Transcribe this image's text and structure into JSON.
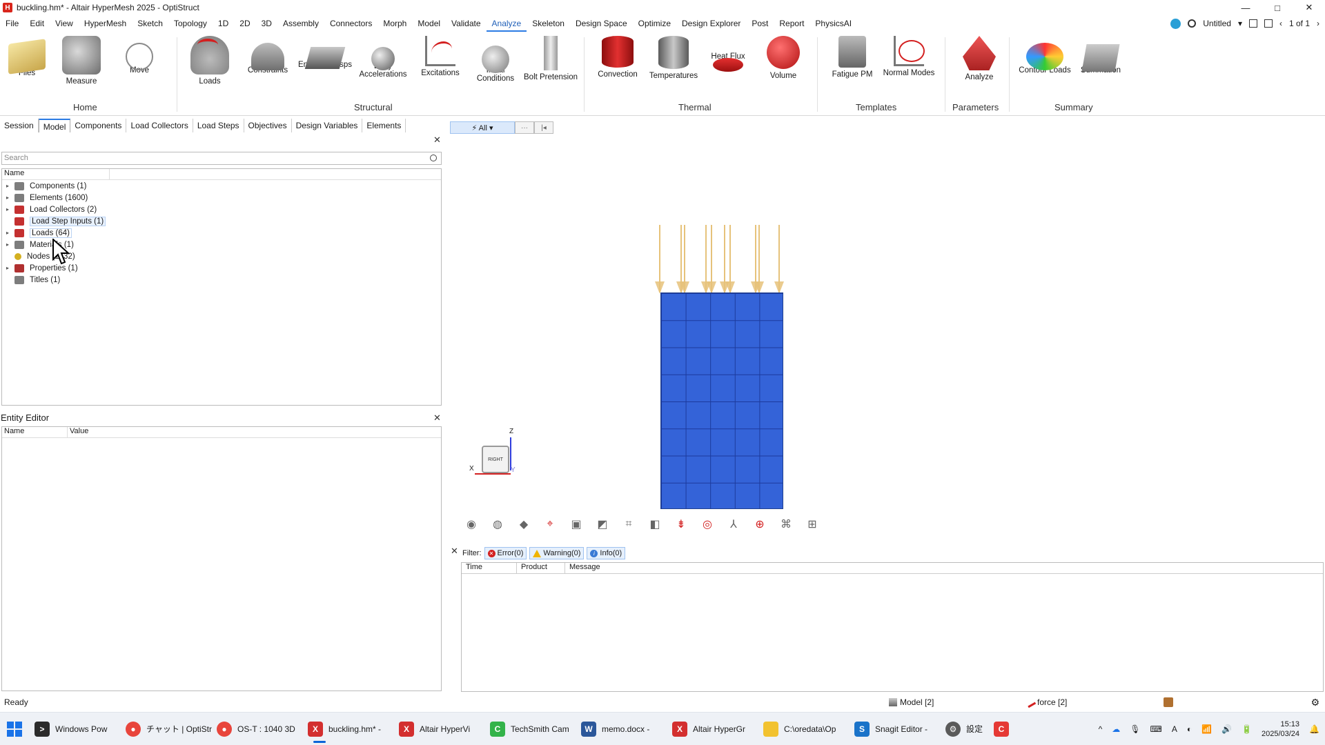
{
  "window": {
    "title": "buckling.hm* - Altair HyperMesh 2025 - OptiStruct",
    "controls": [
      "—",
      "□",
      "✕"
    ]
  },
  "menubar": {
    "items": [
      "File",
      "Edit",
      "View",
      "HyperMesh",
      "Sketch",
      "Topology",
      "1D",
      "2D",
      "3D",
      "Assembly",
      "Connectors",
      "Morph",
      "Model",
      "Validate",
      "Analyze",
      "Skeleton",
      "Design Space",
      "Optimize",
      "Design Explorer",
      "Post",
      "Report",
      "PhysicsAI"
    ],
    "active": "Analyze",
    "session_name": "Untitled",
    "page_counter": "1 of 1"
  },
  "ribbon": {
    "home": {
      "files": "Files",
      "measure": "Measure",
      "move": "Move",
      "group": "Home"
    },
    "structural": {
      "loads": "Loads",
      "constraints": "Constraints",
      "enforced": "Enforced Disps",
      "body_acc": "Body Accelerations",
      "excitations": "Excitations",
      "initial": "Initial Conditions",
      "bolt": "Bolt Pretension",
      "group": "Structural"
    },
    "thermal": {
      "convection": "Convection",
      "temperatures": "Temperatures",
      "heatflux": "Heat Flux",
      "volume": "Volume",
      "group": "Thermal"
    },
    "templates": {
      "fatigue": "Fatigue PM",
      "normal": "Normal Modes",
      "group": "Templates"
    },
    "parameters": {
      "analyze": "Analyze",
      "group": "Parameters"
    },
    "summary": {
      "contour": "Contour Loads",
      "summation": "Summation",
      "group": "Summary"
    }
  },
  "browser_tabs": {
    "tabs": [
      "Session",
      "Model",
      "Components",
      "Load Collectors",
      "Load Steps",
      "Objectives",
      "Design Variables",
      "Elements"
    ],
    "active": "Model"
  },
  "entity_filter": {
    "all": "⚡ All ▾",
    "more": "···",
    "first": "|◂"
  },
  "model_browser": {
    "search_placeholder": "Search",
    "name_header": "Name",
    "rows": [
      {
        "label": "Components  (1)",
        "color": "#7d7d7d"
      },
      {
        "label": "Elements  (1600)",
        "color": "#7d7d7d"
      },
      {
        "label": "Load Collectors  (2)",
        "color": "#c43030"
      },
      {
        "label": "Load Step Inputs  (1)",
        "color": "#c43030"
      },
      {
        "label": "Loads  (64)",
        "color": "#c43030"
      },
      {
        "label": "Materials  (1)",
        "color": "#7d7d7d"
      },
      {
        "label": "Nodes  (1632)",
        "color": "#d4b020"
      },
      {
        "label": "Properties  (1)",
        "color": "#b03030"
      },
      {
        "label": "Titles  (1)",
        "color": "#7d7d7d"
      }
    ]
  },
  "entity_editor": {
    "title": "Entity Editor",
    "name_col": "Name",
    "value_col": "Value"
  },
  "viewport": {
    "view_cube_label": "RIGHT",
    "axis_x": "X",
    "axis_y": "Y",
    "axis_z": "Z",
    "toolbar_icons": [
      "visualization-icon",
      "globe-icon",
      "shaded-icon",
      "fit-icon",
      "component-icon",
      "element-icon",
      "node-icon",
      "cut-plane-icon",
      "contour-icon",
      "pick-icon",
      "no-entry-icon",
      "axis-icon",
      "zoom-icon",
      "measure-icon",
      "lock-icon"
    ]
  },
  "message_log": {
    "filter_label": "Filter:",
    "error": "Error(0)",
    "warning": "Warning(0)",
    "info": "Info(0)",
    "columns": [
      "Time",
      "Product",
      "Message"
    ]
  },
  "status": {
    "ready": "Ready",
    "model": "Model [2]",
    "force": "force [2]"
  },
  "taskbar": {
    "items": [
      {
        "label": "Windows Pow",
        "icon_color": "#2b2b2b",
        "glyph": ">"
      },
      {
        "label": "チャット | OptiStr",
        "icon_color": "#e8453c",
        "glyph": "●"
      },
      {
        "label": "OS-T : 1040 3D",
        "icon_color": "#e8453c",
        "glyph": "●"
      },
      {
        "label": "buckling.hm* -",
        "icon_color": "#d32f2f",
        "glyph": "X"
      },
      {
        "label": "Altair HyperVi",
        "icon_color": "#d32f2f",
        "glyph": "X"
      },
      {
        "label": "TechSmith Cam",
        "icon_color": "#33b34a",
        "glyph": "C"
      },
      {
        "label": "memo.docx -",
        "icon_color": "#2b579a",
        "glyph": "W"
      },
      {
        "label": "Altair HyperGr",
        "icon_color": "#d32f2f",
        "glyph": "X"
      },
      {
        "label": "C:\\oredata\\Op",
        "icon_color": "#f2c230",
        "glyph": ""
      },
      {
        "label": "Snagit Editor -",
        "icon_color": "#1a73c9",
        "glyph": "S"
      },
      {
        "label": "設定",
        "icon_color": "#5a5a5a",
        "glyph": "⚙"
      }
    ],
    "active_index": 3,
    "time": "15:13",
    "date": "2025/03/24",
    "ime": "A"
  }
}
